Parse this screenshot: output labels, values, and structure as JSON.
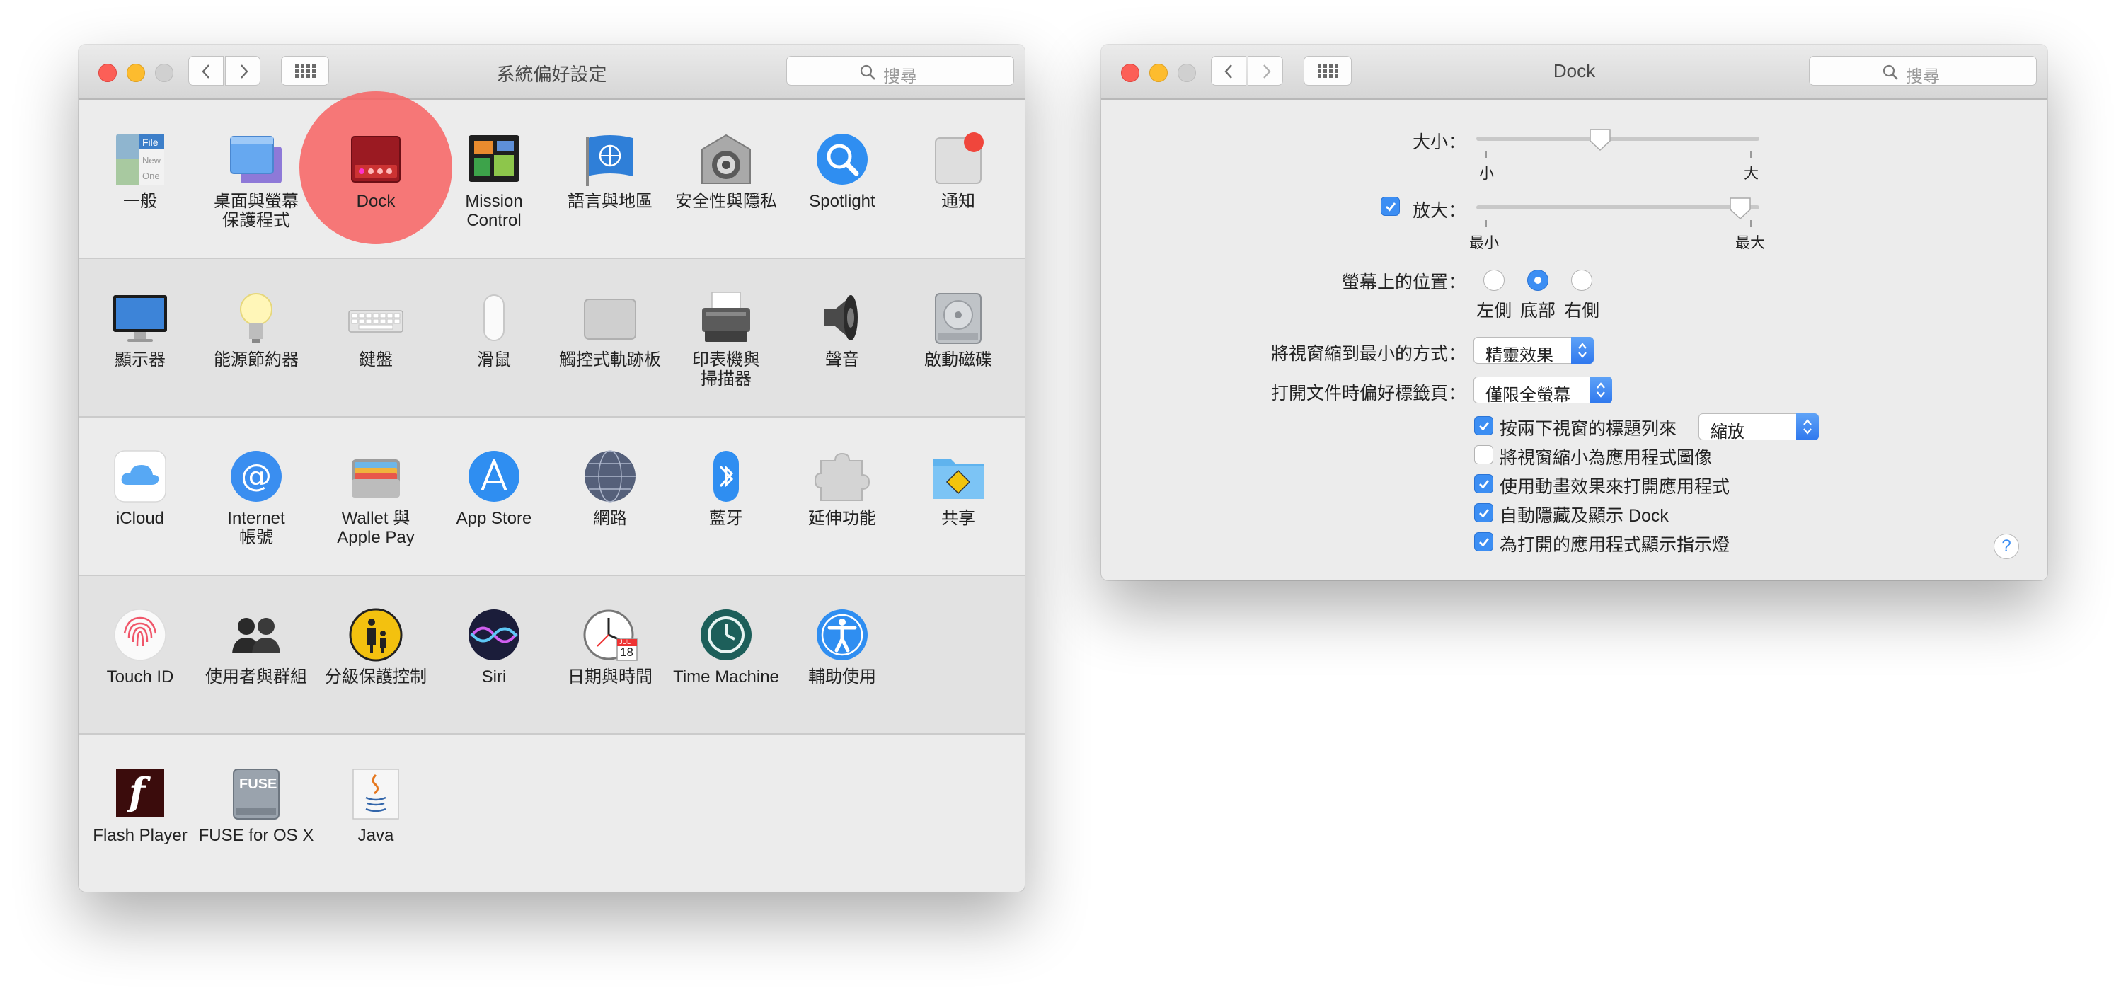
{
  "left_window": {
    "title": "系統偏好設定",
    "search_placeholder": "搜尋",
    "rows": [
      [
        {
          "label": "一般",
          "icon": "general-icon",
          "file_text": [
            "File",
            "New",
            "One"
          ]
        },
        {
          "label": "桌面與螢幕\n保護程式",
          "icon": "desktop-screensaver-icon"
        },
        {
          "label": "Dock",
          "icon": "dock-icon"
        },
        {
          "label": "Mission\nControl",
          "icon": "mission-control-icon"
        },
        {
          "label": "語言與地區",
          "icon": "language-region-icon"
        },
        {
          "label": "安全性與隱私",
          "icon": "security-privacy-icon"
        },
        {
          "label": "Spotlight",
          "icon": "spotlight-icon"
        },
        {
          "label": "通知",
          "icon": "notifications-icon"
        }
      ],
      [
        {
          "label": "顯示器",
          "icon": "displays-icon"
        },
        {
          "label": "能源節約器",
          "icon": "energy-saver-icon"
        },
        {
          "label": "鍵盤",
          "icon": "keyboard-icon"
        },
        {
          "label": "滑鼠",
          "icon": "mouse-icon"
        },
        {
          "label": "觸控式軌跡板",
          "icon": "trackpad-icon"
        },
        {
          "label": "印表機與\n掃描器",
          "icon": "printers-scanners-icon"
        },
        {
          "label": "聲音",
          "icon": "sound-icon"
        },
        {
          "label": "啟動磁碟",
          "icon": "startup-disk-icon"
        }
      ],
      [
        {
          "label": "iCloud",
          "icon": "icloud-icon"
        },
        {
          "label": "Internet\n帳號",
          "icon": "internet-accounts-icon"
        },
        {
          "label": "Wallet 與\nApple Pay",
          "icon": "wallet-icon"
        },
        {
          "label": "App Store",
          "icon": "app-store-icon"
        },
        {
          "label": "網路",
          "icon": "network-icon"
        },
        {
          "label": "藍牙",
          "icon": "bluetooth-icon"
        },
        {
          "label": "延伸功能",
          "icon": "extensions-icon"
        },
        {
          "label": "共享",
          "icon": "sharing-icon"
        }
      ],
      [
        {
          "label": "Touch ID",
          "icon": "touch-id-icon"
        },
        {
          "label": "使用者與群組",
          "icon": "users-groups-icon"
        },
        {
          "label": "分級保護控制",
          "icon": "parental-controls-icon"
        },
        {
          "label": "Siri",
          "icon": "siri-icon"
        },
        {
          "label": "日期與時間",
          "icon": "date-time-icon",
          "calendar_text": [
            "JUL",
            "18"
          ]
        },
        {
          "label": "Time Machine",
          "icon": "time-machine-icon"
        },
        {
          "label": "輔助使用",
          "icon": "accessibility-icon"
        }
      ],
      [
        {
          "label": "Flash Player",
          "icon": "flash-player-icon",
          "glyph": "f"
        },
        {
          "label": "FUSE for OS X",
          "icon": "fuse-icon",
          "glyph": "FUSE"
        },
        {
          "label": "Java",
          "icon": "java-icon"
        }
      ]
    ],
    "highlight_color": "#f86060"
  },
  "right_window": {
    "title": "Dock",
    "search_placeholder": "搜尋",
    "size": {
      "label": "大小：",
      "min_label": "小",
      "max_label": "大",
      "value_fraction": 0.43
    },
    "magnification": {
      "label": "放大：",
      "checked": true,
      "min_label": "最小",
      "max_label": "最大",
      "value_fraction": 0.96
    },
    "position": {
      "label": "螢幕上的位置：",
      "options": [
        "左側",
        "底部",
        "右側"
      ],
      "selected": "底部"
    },
    "minimize_effect": {
      "label": "將視窗縮到最小的方式：",
      "value": "精靈效果"
    },
    "prefer_tabs": {
      "label": "打開文件時偏好標籤頁：",
      "value": "僅限全螢幕"
    },
    "double_click": {
      "label": "按兩下視窗的標題列來",
      "checked": true,
      "value": "縮放"
    },
    "checkboxes": [
      {
        "label": "將視窗縮小為應用程式圖像",
        "checked": false
      },
      {
        "label": "使用動畫效果來打開應用程式",
        "checked": true
      },
      {
        "label": "自動隱藏及顯示 Dock",
        "checked": true
      },
      {
        "label": "為打開的應用程式顯示指示燈",
        "checked": true
      }
    ],
    "help_label": "?"
  },
  "colors": {
    "accent": "#3c8ef3",
    "window_bg": "#ececec",
    "alt_row": "#e2e2e2"
  }
}
